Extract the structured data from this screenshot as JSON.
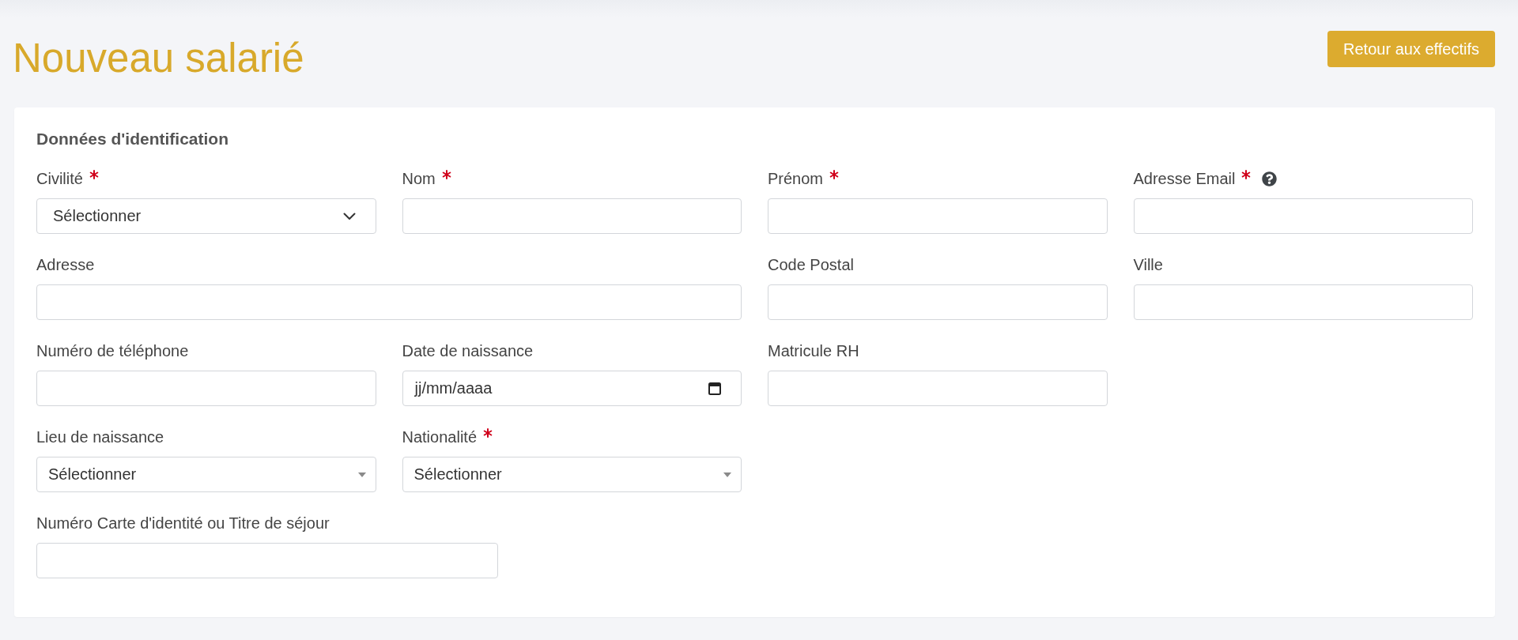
{
  "header": {
    "title": "Nouveau salarié",
    "back_button": "Retour aux effectifs"
  },
  "form": {
    "section_title": "Données d'identification",
    "fields": [
      {
        "kind": "select",
        "label": "Civilité",
        "required": true,
        "help": false,
        "value": "Sélectionner"
      },
      {
        "kind": "text",
        "label": "Nom",
        "required": true,
        "help": false
      },
      {
        "kind": "text",
        "label": "Prénom",
        "required": true,
        "help": false
      },
      {
        "kind": "text",
        "label": "Adresse Email",
        "required": true,
        "help": true
      },
      {
        "kind": "text",
        "label": "Adresse",
        "required": false,
        "help": false
      },
      {
        "kind": "text",
        "label": "Code Postal",
        "required": false,
        "help": false
      },
      {
        "kind": "text",
        "label": "Ville",
        "required": false,
        "help": false
      },
      {
        "kind": "text",
        "label": "Numéro de téléphone",
        "required": false,
        "help": false
      },
      {
        "kind": "date",
        "label": "Date de naissance",
        "required": false,
        "help": false,
        "placeholder": "jj/mm/aaaa"
      },
      {
        "kind": "text",
        "label": "Matricule RH",
        "required": false,
        "help": false
      },
      {
        "kind": "combobox",
        "label": "Lieu de naissance",
        "required": false,
        "help": false,
        "value": "Sélectionner"
      },
      {
        "kind": "combobox",
        "label": "Nationalité",
        "required": true,
        "help": false,
        "value": "Sélectionner"
      },
      {
        "kind": "text",
        "label": "Numéro Carte d'identité ou Titre de séjour",
        "required": false,
        "help": false
      }
    ]
  }
}
